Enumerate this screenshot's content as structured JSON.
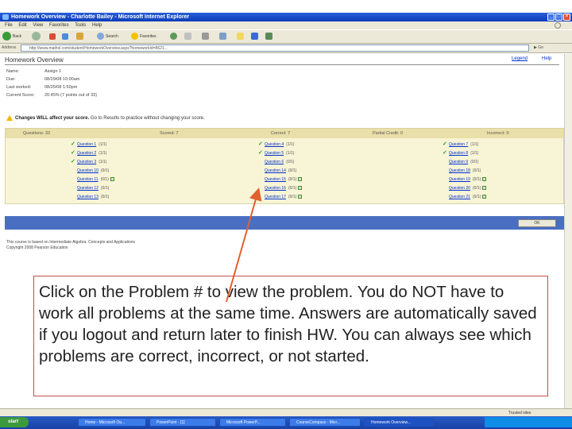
{
  "window": {
    "title": "Homework Overview - Charlotte Bailey - Microsoft Internet Explorer",
    "menu": [
      "File",
      "Edit",
      "View",
      "Favorites",
      "Tools",
      "Help"
    ]
  },
  "toolbar": {
    "back_label": "Back",
    "search_label": "Search",
    "favorites_label": "Favorites"
  },
  "addressbar": {
    "label": "Address",
    "url": "http://www.mathxl.com/student/HomeworkOverview.aspx?homeworkId=8621..."
  },
  "page": {
    "heading": "Homework Overview",
    "legend_link": "Legend",
    "help_link": "Help",
    "info": [
      {
        "key": "Name:",
        "value": "Assign 1"
      },
      {
        "key": "Due:",
        "value": "08/29/08 10:00am"
      },
      {
        "key": "Last worked:",
        "value": "08/25/08 1:50pm"
      },
      {
        "key": "Current Score:",
        "value": "20.45% (7 points out of 33)"
      }
    ],
    "warning_bold": "Changes WILL affect your score.",
    "warning_rest": "Go to Results to practice without changing your score."
  },
  "results": {
    "columns": [
      "Questions: 33",
      "Scored: 7",
      "Correct: 7",
      "Partial Credit: 0",
      "Incorrect: 0"
    ],
    "col1": [
      {
        "check": true,
        "label": "Question 1",
        "status": "(1/1)",
        "sq": false
      },
      {
        "check": true,
        "label": "Question 2",
        "status": "(1/1)",
        "sq": false
      },
      {
        "check": true,
        "label": "Question 3",
        "status": "(1/1)",
        "sq": false
      },
      {
        "check": false,
        "label": "Question 10",
        "status": "(0/1)",
        "sq": false
      },
      {
        "check": false,
        "label": "Question 11",
        "status": "(0/1)",
        "sq": true
      },
      {
        "check": false,
        "label": "Question 12",
        "status": "(0/1)",
        "sq": false
      },
      {
        "check": false,
        "label": "Question 13",
        "status": "(0/1)",
        "sq": false
      }
    ],
    "col2": [
      {
        "check": true,
        "label": "Question 4",
        "status": "(1/1)",
        "sq": false
      },
      {
        "check": true,
        "label": "Question 5",
        "status": "(1/1)",
        "sq": false
      },
      {
        "check": false,
        "label": "Question 6",
        "status": "(0/1)",
        "sq": false
      },
      {
        "check": false,
        "label": "Question 14",
        "status": "(0/1)",
        "sq": false
      },
      {
        "check": false,
        "label": "Question 15",
        "status": "(0/1)",
        "sq": true
      },
      {
        "check": false,
        "label": "Question 16",
        "status": "(0/1)",
        "sq": true
      },
      {
        "check": false,
        "label": "Question 17",
        "status": "(0/1)",
        "sq": true
      }
    ],
    "col3": [
      {
        "check": true,
        "label": "Question 7",
        "status": "(1/1)",
        "sq": false
      },
      {
        "check": true,
        "label": "Question 8",
        "status": "(1/1)",
        "sq": false
      },
      {
        "check": false,
        "label": "Question 9",
        "status": "(0/1)",
        "sq": false
      },
      {
        "check": false,
        "label": "Question 18",
        "status": "(0/1)",
        "sq": false
      },
      {
        "check": false,
        "label": "Question 19",
        "status": "(0/1)",
        "sq": true
      },
      {
        "check": false,
        "label": "Question 20",
        "status": "(0/1)",
        "sq": true
      },
      {
        "check": false,
        "label": "Question 21",
        "status": "(0/1)",
        "sq": true
      }
    ],
    "ok_label": "OK"
  },
  "footnotes": [
    "This course is based on Intermediate Algebra: Concepts and Applications",
    "Copyright 2008 Pearson Education"
  ],
  "callout": {
    "text": "Click on the Problem # to view the problem.  You do NOT have to work all problems at the same time.  Answers are automatically saved if you logout and return later to finish HW.  You can always see which problems are correct, incorrect, or not started."
  },
  "taskbar": {
    "start_label": "start",
    "tasks": [
      "Home - Microsoft Ou...",
      "PowerPoint - [1]",
      "Microsoft PowerP...",
      "CourseCompass - Micr...",
      "Homework Overview..."
    ],
    "tray_label": "Trusted sites"
  },
  "colors": {
    "titlebar": "#0a3cb8",
    "results_bg": "#f8f4d6",
    "bluebar": "#4a6fc2",
    "callout_border": "#c0504d",
    "arrow": "#e06030"
  }
}
